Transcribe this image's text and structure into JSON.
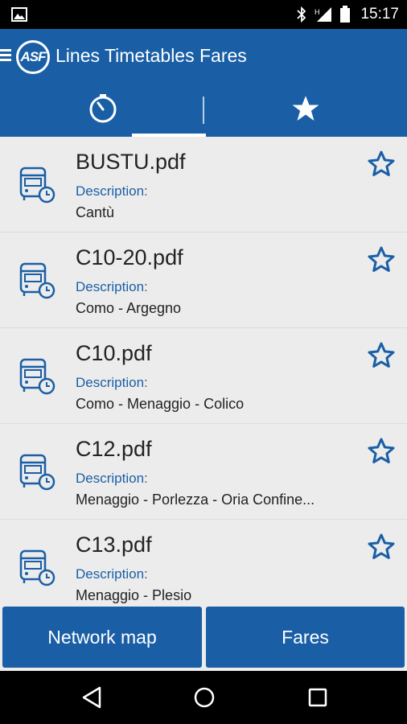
{
  "status_bar": {
    "time": "15:17",
    "icons": [
      "image-icon",
      "bluetooth-icon",
      "signal-icon",
      "battery-icon"
    ],
    "signal_label": "H"
  },
  "app_bar": {
    "logo_text": "ASF",
    "title": "Lines Timetables Fares",
    "tabs": [
      {
        "name": "recent",
        "icon": "timer-icon",
        "selected": true
      },
      {
        "name": "favorites",
        "icon": "star-icon",
        "selected": false
      }
    ]
  },
  "list": {
    "items": [
      {
        "filename": "BUSTU.pdf",
        "description_label": "Description:",
        "description": "Cantù"
      },
      {
        "filename": "C10-20.pdf",
        "description_label": "Description:",
        "description": "Como - Argegno"
      },
      {
        "filename": "C10.pdf",
        "description_label": "Description:",
        "description": "Como - Menaggio - Colico"
      },
      {
        "filename": "C12.pdf",
        "description_label": "Description:",
        "description": "Menaggio - Porlezza - Oria Confine..."
      },
      {
        "filename": "C13.pdf",
        "description_label": "Description:",
        "description": "Menaggio - Plesio"
      }
    ]
  },
  "buttons": {
    "network_map": "Network map",
    "fares": "Fares"
  },
  "colors": {
    "primary": "#1a5fa6",
    "list_background": "#ececec",
    "text": "#222222"
  }
}
